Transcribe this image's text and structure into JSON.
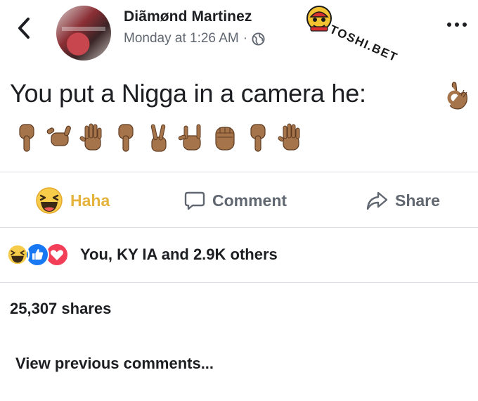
{
  "post": {
    "author_name": "Diãmønd Martinez",
    "timestamp": "Monday at 1:26 AM",
    "separator": "·",
    "privacy_icon": "globe-icon",
    "text": "You put a Nigga in a camera he:",
    "emoji_sequence": [
      "ok-hand",
      "point-down",
      "call-me-hand",
      "raised-hand-fingers-splayed",
      "point-down",
      "victory-hand",
      "love-you-gesture",
      "raised-fist",
      "point-down",
      "raised-hand-fingers-splayed"
    ]
  },
  "watermark": {
    "text": "TOSHI.BET"
  },
  "actions": {
    "haha_label": "Haha",
    "comment_label": "Comment",
    "share_label": "Share"
  },
  "reactions": {
    "icons": [
      "haha-icon",
      "like-icon",
      "love-icon"
    ],
    "summary": "You, KY IA and 2.9K others"
  },
  "shares": {
    "count_label": "25,307 shares"
  },
  "comments": {
    "view_previous_label": "View previous comments..."
  },
  "colors": {
    "haha_yellow": "#e5b33c",
    "like_blue": "#1877f2",
    "love_red": "#f33e58",
    "secondary_text": "#606770",
    "divider": "#dadde1",
    "skin_tone": "#a5744a"
  }
}
